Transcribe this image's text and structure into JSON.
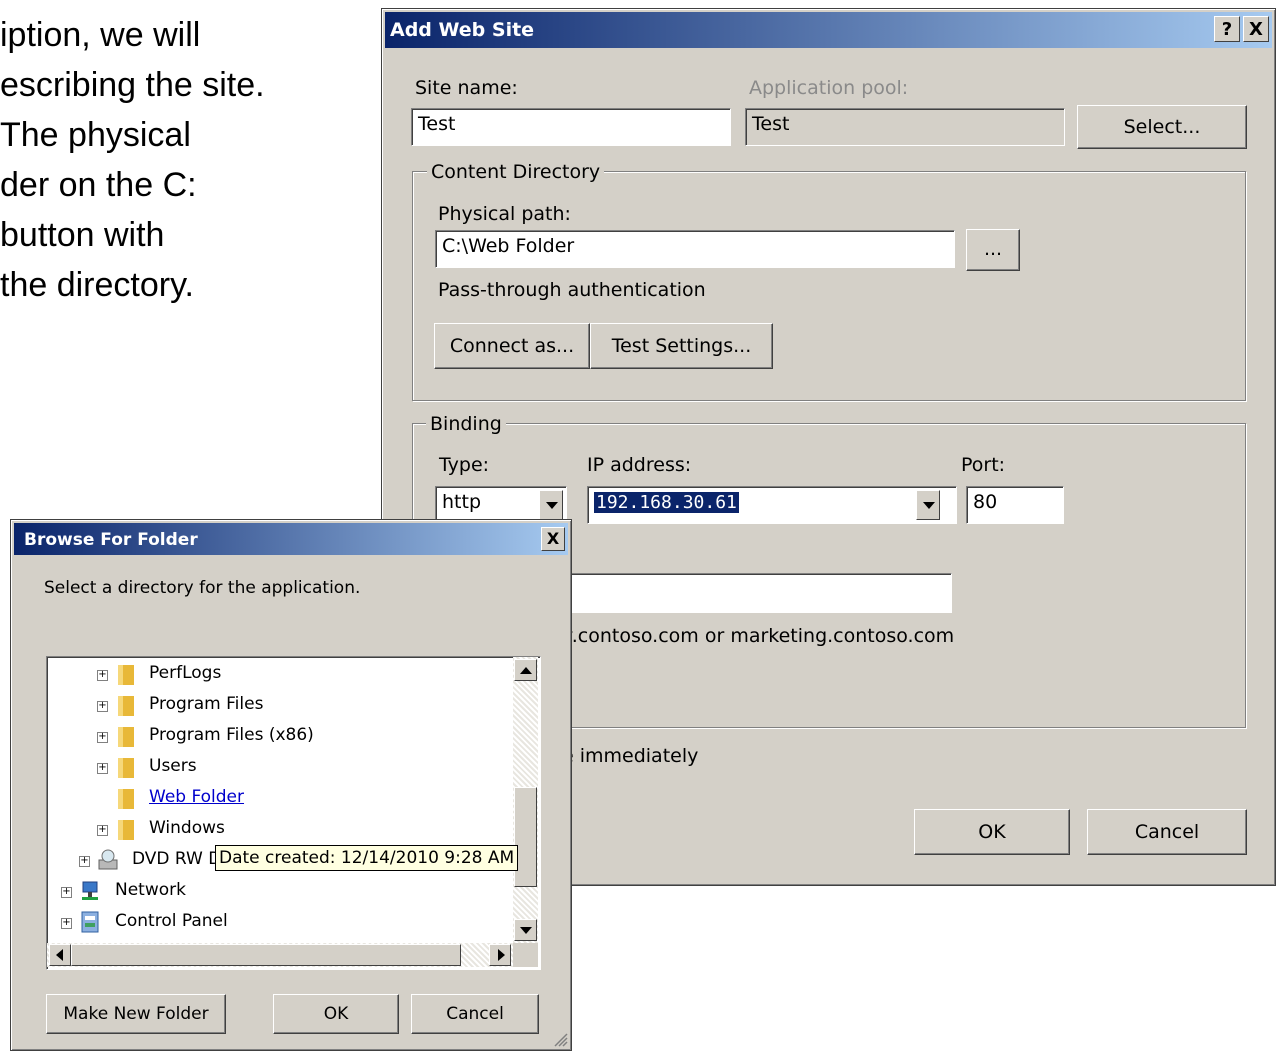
{
  "slide": {
    "lines": [
      "iption, we will",
      "escribing the site.",
      "The physical",
      "der on the C:",
      "button with",
      "the directory."
    ]
  },
  "add_web_site": {
    "title": "Add Web Site",
    "help_btn": "?",
    "close_btn": "X",
    "site_name_label": "Site name:",
    "site_name_value": "Test",
    "app_pool_label": "Application pool:",
    "app_pool_value": "Test",
    "select_btn": "Select...",
    "content_dir_group": "Content Directory",
    "physical_path_label": "Physical path:",
    "physical_path_value": "C:\\Web Folder",
    "browse_btn": "...",
    "passthrough_label": "Pass-through authentication",
    "connect_as_btn": "Connect as...",
    "test_settings_btn": "Test Settings...",
    "binding_group": "Binding",
    "type_label": "Type:",
    "type_value": "http",
    "ip_label": "IP address:",
    "ip_value": "192.168.30.61",
    "port_label": "Port:",
    "port_value": "80",
    "host_example_partial": "v.contoso.com or marketing.contoso.com",
    "start_partial": "e immediately",
    "ok_btn": "OK",
    "cancel_btn": "Cancel"
  },
  "browse_for_folder": {
    "title": "Browse For Folder",
    "close_btn": "X",
    "description": "Select a directory for the application.",
    "tree_items": [
      {
        "name": "PerfLogs",
        "expander": "+"
      },
      {
        "name": "Program Files",
        "expander": "+"
      },
      {
        "name": "Program Files (x86)",
        "expander": "+"
      },
      {
        "name": "Users",
        "expander": "+"
      },
      {
        "name": "Web Folder",
        "expander": ""
      },
      {
        "name": "Windows",
        "expander": "+"
      },
      {
        "name": "DVD RW D",
        "expander": "+"
      },
      {
        "name": "Network",
        "expander": "+"
      },
      {
        "name": "Control Panel",
        "expander": "+"
      }
    ],
    "tooltip": "Date created: 12/14/2010 9:28 AM",
    "make_new_folder_btn": "Make New Folder",
    "ok_btn": "OK",
    "cancel_btn": "Cancel"
  },
  "colors": {
    "title_bar_start": "#0a246a",
    "title_bar_end": "#a6caf0",
    "dialog_face": "#d4d0c8",
    "selection": "#0a246a",
    "link": "#0000cc",
    "tooltip_bg": "#ffffe1"
  }
}
